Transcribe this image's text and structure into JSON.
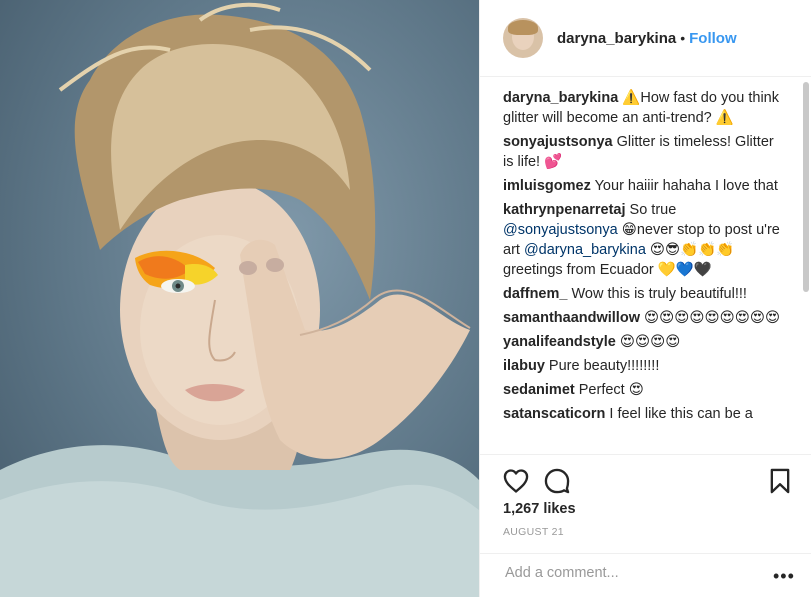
{
  "header": {
    "username": "daryna_barykina",
    "separator": "•",
    "follow_label": "Follow"
  },
  "comments": [
    {
      "user": "daryna_barykina",
      "text": " ⚠️How fast do you think glitter will become an anti-trend? ⚠️"
    },
    {
      "user": "sonyajustsonya",
      "text": " Glitter is timeless! Glitter is life! 💕"
    },
    {
      "user": "imluisgomez",
      "text": " Your haiiir hahaha I love that"
    },
    {
      "user": "kathrynpenarretaj",
      "text_before": " So true ",
      "mention1": "@sonyajustsonya",
      "text_middle": " 😁never stop to post u're art ",
      "mention2": "@daryna_barykina",
      "text_after": " 😍😎👏👏👏 greetings from Ecuador 💛💙🖤"
    },
    {
      "user": "daffnem_",
      "text": " Wow this is truly beautiful!!!"
    },
    {
      "user": "samanthaandwillow",
      "text": " 😍😍😍😍😍😍😍😍😍"
    },
    {
      "user": "yanalifeandstyle",
      "text": " 😍😍😍😍"
    },
    {
      "user": "ilabuy",
      "text": " Pure beauty!!!!!!!!"
    },
    {
      "user": "sedanimet",
      "text": " Perfect 😍"
    },
    {
      "user": "satanscaticorn",
      "text": " I feel like this can be a"
    }
  ],
  "actions": {
    "likes": "1,267 likes",
    "date": "AUGUST 21",
    "comment_placeholder": "Add a comment...",
    "more_label": "•••"
  },
  "icons": {
    "like": "heart-icon",
    "comment": "comment-icon",
    "save": "bookmark-icon",
    "more": "more-options-icon"
  },
  "colors": {
    "link_blue": "#3897f0",
    "mention_blue": "#003569",
    "text": "#262626",
    "muted": "#999999",
    "border": "#efefef"
  }
}
